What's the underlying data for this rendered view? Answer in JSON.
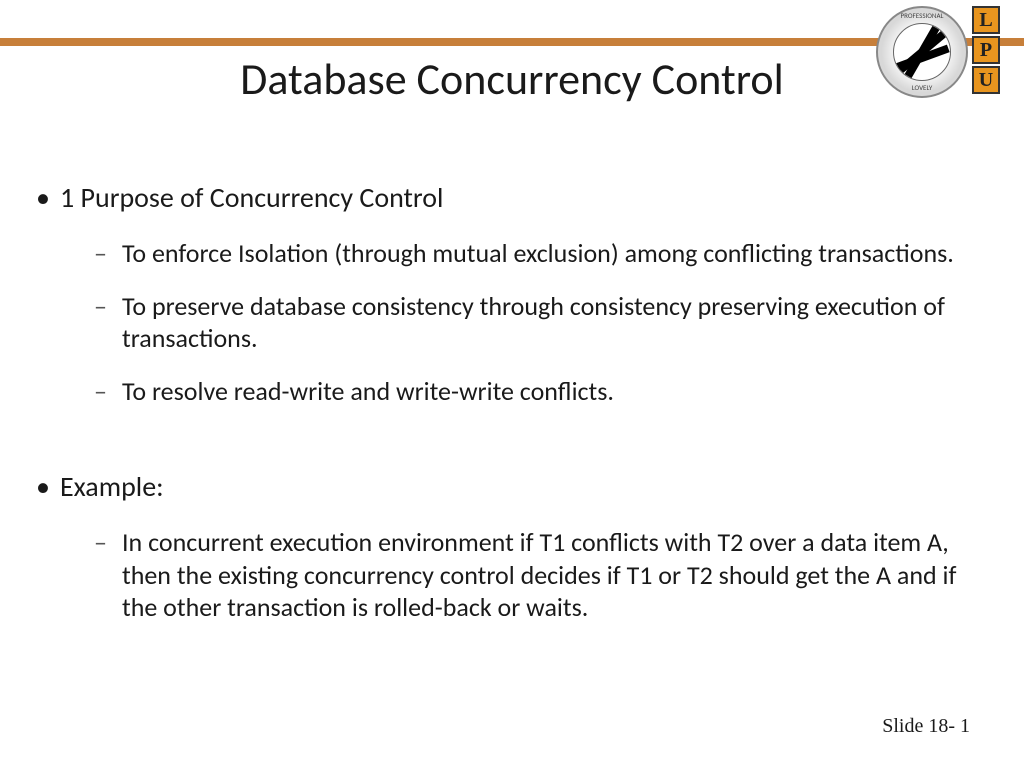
{
  "logo": {
    "seal_top": "PROFESSIONAL",
    "seal_bottom": "LOVELY",
    "letters": [
      "L",
      "P",
      "U"
    ]
  },
  "title": "Database Concurrency Control",
  "content": {
    "section1": {
      "heading": "1   Purpose of Concurrency Control",
      "points": [
        "To enforce Isolation (through mutual exclusion) among conflicting transactions.",
        "To preserve database consistency through consistency preserving execution of transactions.",
        "To resolve read-write and write-write conflicts."
      ]
    },
    "section2": {
      "heading": "Example:",
      "points": [
        "In concurrent execution environment if T1 conflicts with T2 over a data item A, then the existing concurrency control decides if T1 or T2 should get the A and if the other transaction is rolled-back or waits."
      ]
    }
  },
  "footer": {
    "slide_number": "Slide 18- 1"
  }
}
